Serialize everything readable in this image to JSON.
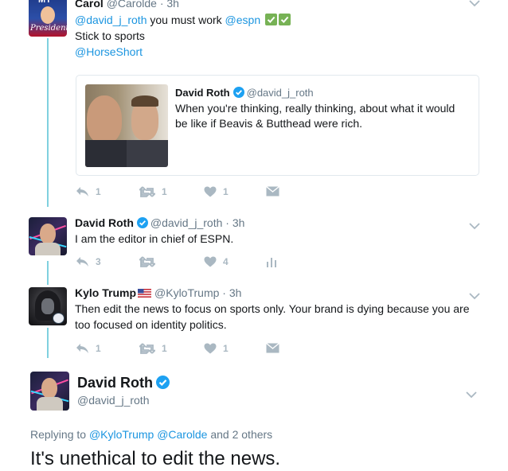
{
  "tweet1": {
    "author_name": "Carol",
    "author_handle": "@Carolde",
    "time": "3h",
    "mention1": "@david_j_roth",
    "text1": " you must work ",
    "mention2": "@espn",
    "line2": "Stick to sports",
    "line3": "@HorseShort",
    "avatar_text_top": "MY",
    "avatar_text_bottom": "President",
    "quoted": {
      "author_name": "David Roth",
      "author_handle": "@david_j_roth",
      "text_line1": "When you're thinking, really thinking, about what it would",
      "text_line2": "be like if Beavis & Butthead were rich."
    },
    "actions": {
      "reply": "1",
      "retweet": "1",
      "like": "1"
    }
  },
  "tweet2": {
    "author_name": "David Roth",
    "author_handle": "@david_j_roth",
    "time": "3h",
    "text": "I am the editor in chief of ESPN.",
    "actions": {
      "reply": "3",
      "retweet": "",
      "like": "4"
    }
  },
  "tweet3": {
    "author_name": "Kylo Trump",
    "author_handle": "@KyloTrump",
    "time": "3h",
    "text_line1": "Then edit the news to focus on sports only. Your brand is dying because you are",
    "text_line2": "too focused on identity politics.",
    "actions": {
      "reply": "1",
      "retweet": "1",
      "like": "1"
    }
  },
  "main_tweet": {
    "author_name": "David Roth",
    "author_handle": "@david_j_roth",
    "replying_prefix": "Replying to ",
    "replying_mention1": "@KyloTrump",
    "replying_mention2": "@Carolde",
    "replying_suffix": " and 2 others",
    "text": "It's unethical to edit the news."
  },
  "colors": {
    "link": "#1b95e0",
    "thread_line": "#7fd1df",
    "verified": "#1da1f2",
    "muted": "#657786",
    "icon": "#aab8c2"
  }
}
